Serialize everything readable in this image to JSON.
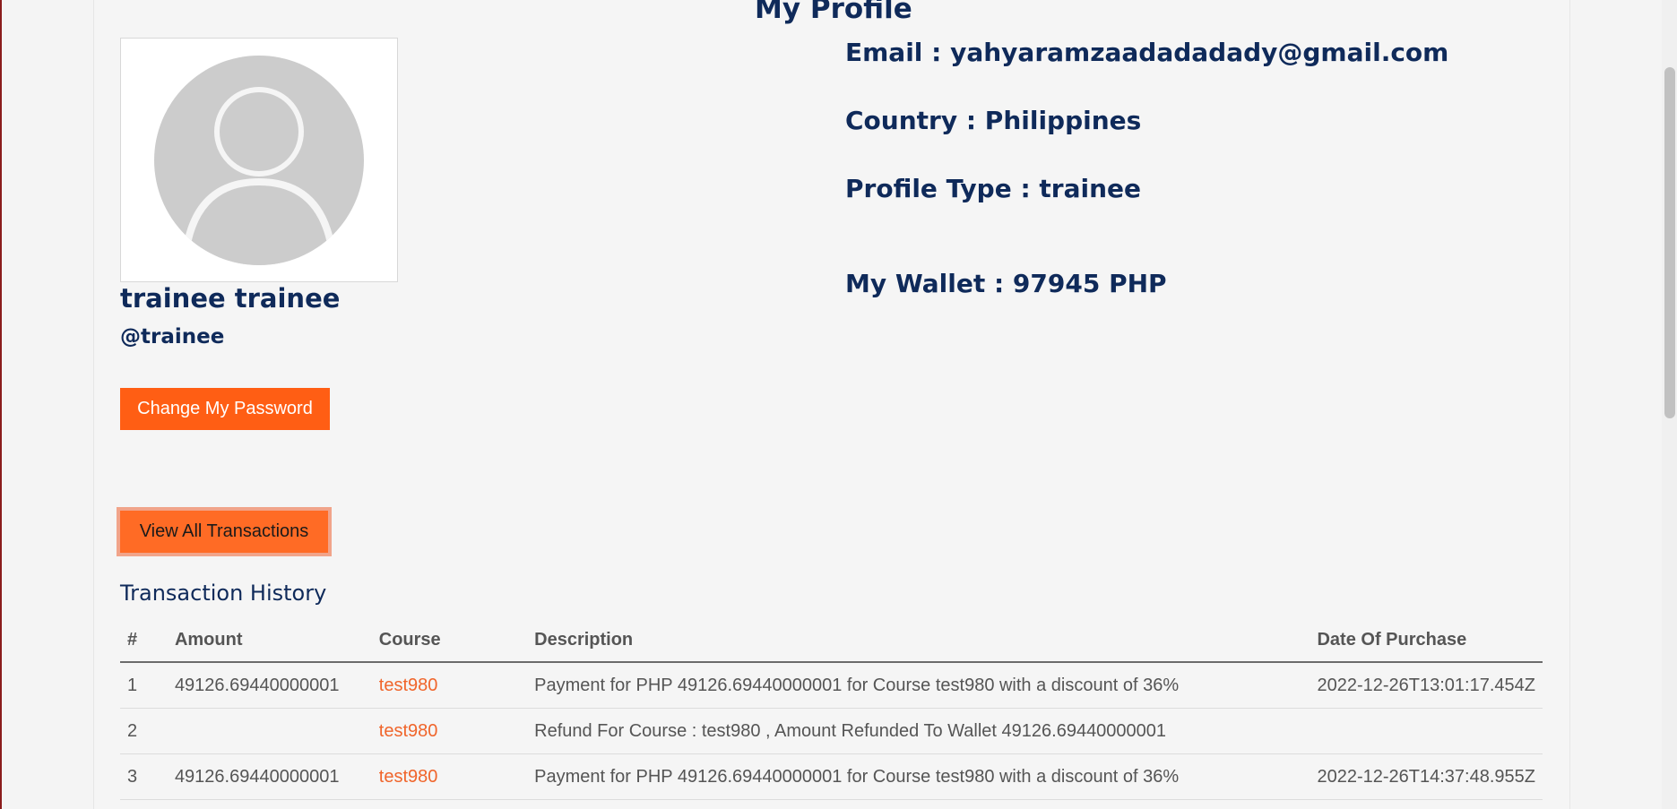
{
  "page": {
    "title": "My Profile"
  },
  "profile": {
    "avatar_icon": "user-avatar-placeholder",
    "full_name": "trainee trainee",
    "username": "@trainee",
    "email": "Email : yahyaramzaadadadady@gmail.com",
    "country": "Country : Philippines",
    "profile_type": "Profile Type : trainee",
    "wallet": "My Wallet : 97945 PHP"
  },
  "actions": {
    "change_password": "Change My Password",
    "view_transactions": "View All Transactions"
  },
  "transactions": {
    "title": "Transaction History",
    "columns": [
      "#",
      "Amount",
      "Course",
      "Description",
      "Date Of Purchase"
    ],
    "rows": [
      {
        "idx": "1",
        "amount": "49126.69440000001",
        "course": "test980",
        "description": "Payment for PHP 49126.69440000001 for Course test980 with a discount of 36%",
        "date": "2022-12-26T13:01:17.454Z"
      },
      {
        "idx": "2",
        "amount": "",
        "course": "test980",
        "description": "Refund For Course : test980 , Amount Refunded To Wallet 49126.69440000001",
        "date": ""
      },
      {
        "idx": "3",
        "amount": "49126.69440000001",
        "course": "test980",
        "description": "Payment for PHP 49126.69440000001 for Course test980 with a discount of 36%",
        "date": "2022-12-26T14:37:48.955Z"
      }
    ]
  },
  "colors": {
    "heading": "#0f2a5a",
    "accent": "#ff5e14",
    "link": "#f0652b"
  }
}
